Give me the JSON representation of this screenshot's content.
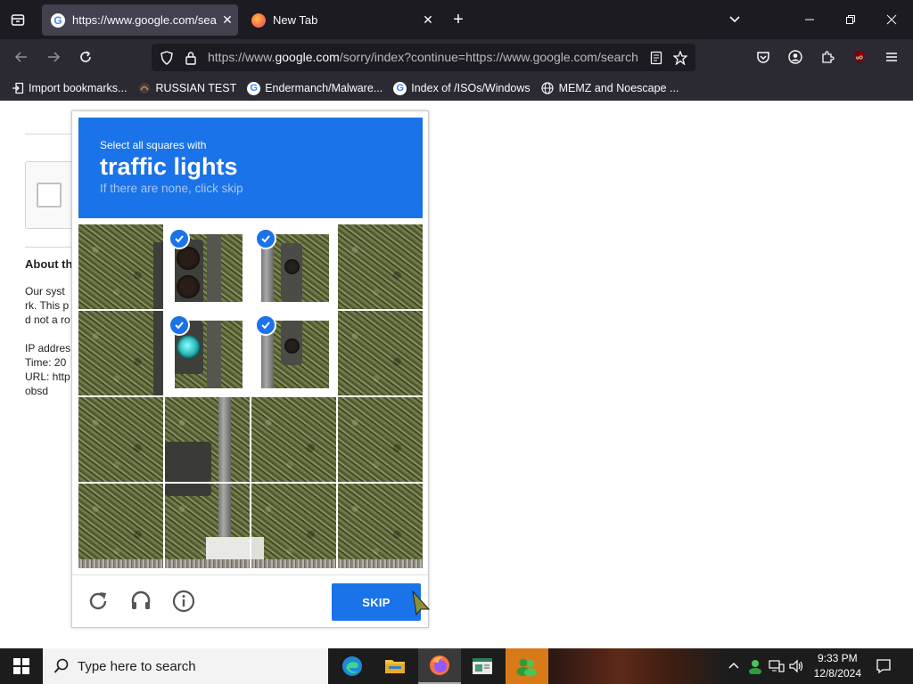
{
  "browser": {
    "tabs": [
      {
        "title": "https://www.google.com/searc",
        "active": true
      },
      {
        "title": "New Tab",
        "active": false
      }
    ],
    "url": {
      "prefix": "https://www.",
      "domain": "google.com",
      "suffix": "/sorry/index?continue=https://www.google.com/search"
    },
    "bookmarks": [
      {
        "label": "Import bookmarks...",
        "icon": "import-icon"
      },
      {
        "label": "RUSSIAN TEST",
        "icon": "globe-icon"
      },
      {
        "label": "Endermanch/Malware...",
        "icon": "google-icon"
      },
      {
        "label": "Index of /ISOs/Windows",
        "icon": "google-icon"
      },
      {
        "label": "MEMZ and Noescape ...",
        "icon": "globe-icon"
      }
    ],
    "accent": "#1c1b22"
  },
  "page_behind": {
    "about_title": "About th",
    "lines": [
      "Our syst",
      "rk. This p",
      "d not a ro",
      "",
      "IP addres",
      "Time: 20",
      "URL: http",
      "obsd"
    ]
  },
  "captcha": {
    "instruction": "Select all squares with",
    "target": "traffic lights",
    "hint": "If there are none, click skip",
    "skip_label": "SKIP",
    "selected_tiles": [
      1,
      2,
      5,
      6
    ],
    "header_color": "#1a73e8"
  },
  "taskbar": {
    "search_placeholder": "Type here to search",
    "time": "9:33 PM",
    "date": "12/8/2024"
  }
}
